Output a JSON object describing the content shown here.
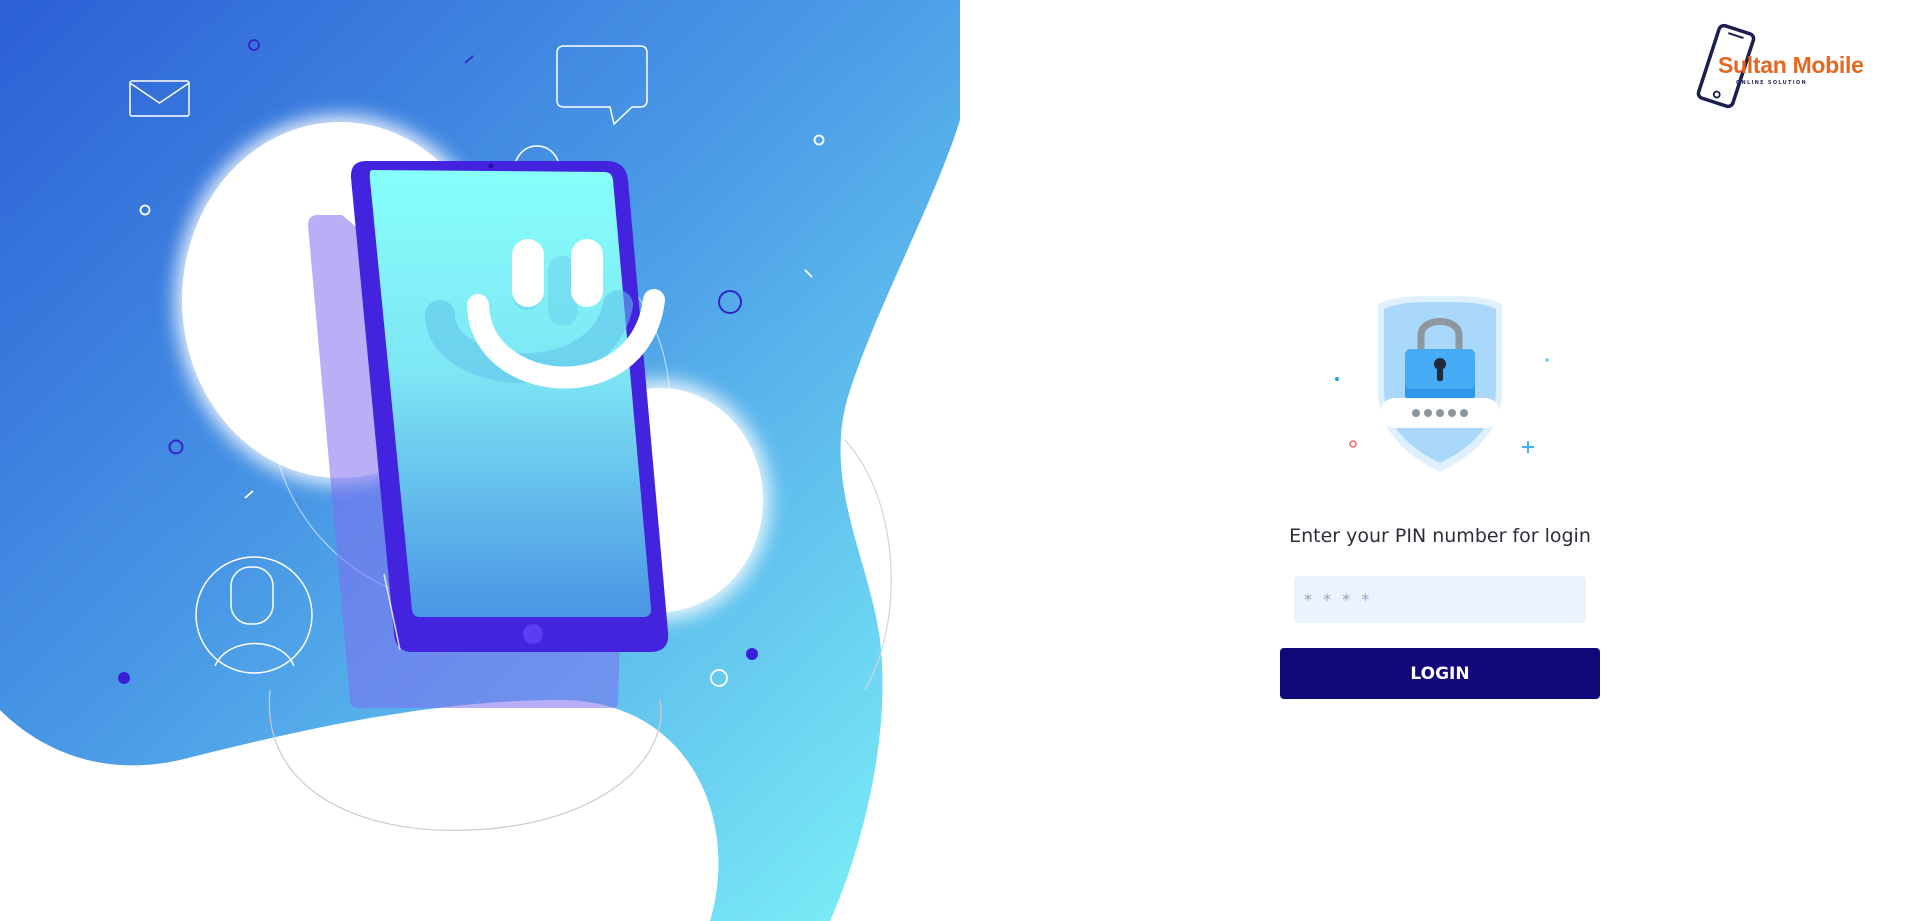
{
  "brand": {
    "name": "Sultan Mobile",
    "tagline": "ONLINE SOLUTION",
    "logo_icon": "smartphone-icon",
    "name_color": "#e4681f"
  },
  "illustration": {
    "icons": [
      "envelope-icon",
      "chat-bubble-icon",
      "user-avatar-icon",
      "smartphone-icon",
      "smiley-icon"
    ]
  },
  "login": {
    "shield_icon": "shield-lock-icon",
    "title": "Enter your PIN number for login",
    "pin_placeholder": "* * * *",
    "pin_value": "",
    "button_label": "LOGIN",
    "button_color": "#13087a",
    "input_background": "#eaf3fe"
  }
}
